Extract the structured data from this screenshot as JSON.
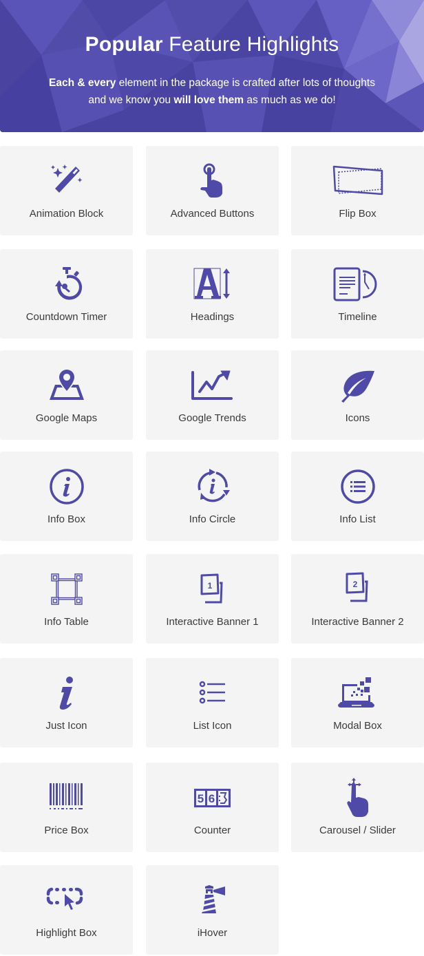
{
  "header": {
    "title_bold": "Popular",
    "title_rest": "Feature Highlights",
    "subtitle_line1_bold": "Each & every",
    "subtitle_line1_rest": "element in the package is crafted after lots of thoughts",
    "subtitle_line2_pre": "and we know you",
    "subtitle_line2_bold": "will love them",
    "subtitle_line2_post": "as much as we do!"
  },
  "colors": {
    "accent": "#4f4aa8",
    "banner": "#4e48a6",
    "card_bg": "#f4f4f4",
    "label": "#3a3a3a"
  },
  "features": [
    {
      "label": "Animation Block",
      "icon": "magic-wand-icon"
    },
    {
      "label": "Advanced Buttons",
      "icon": "pointer-tap-icon"
    },
    {
      "label": "Flip Box",
      "icon": "flip-box-icon"
    },
    {
      "label": "Countdown Timer",
      "icon": "stopwatch-icon"
    },
    {
      "label": "Headings",
      "icon": "heading-text-icon"
    },
    {
      "label": "Timeline",
      "icon": "document-clock-icon"
    },
    {
      "label": "Google Maps",
      "icon": "map-pin-icon"
    },
    {
      "label": "Google Trends",
      "icon": "trend-chart-icon"
    },
    {
      "label": "Icons",
      "icon": "leaf-icon"
    },
    {
      "label": "Info Box",
      "icon": "info-circle-icon"
    },
    {
      "label": "Info Circle",
      "icon": "info-cycle-icon"
    },
    {
      "label": "Info List",
      "icon": "list-circle-icon"
    },
    {
      "label": "Info Table",
      "icon": "table-frame-icon"
    },
    {
      "label": "Interactive Banner 1",
      "icon": "banner-one-icon"
    },
    {
      "label": "Interactive Banner 2",
      "icon": "banner-two-icon"
    },
    {
      "label": "Just Icon",
      "icon": "info-letter-icon"
    },
    {
      "label": "List Icon",
      "icon": "bullet-list-icon"
    },
    {
      "label": "Modal Box",
      "icon": "laptop-pixels-icon"
    },
    {
      "label": "Price Box",
      "icon": "barcode-icon"
    },
    {
      "label": "Counter",
      "icon": "counter-digits-icon"
    },
    {
      "label": "Carousel / Slider",
      "icon": "swipe-hand-icon"
    },
    {
      "label": "Highlight Box",
      "icon": "dashed-select-cursor-icon"
    },
    {
      "label": "iHover",
      "icon": "lighthouse-icon"
    }
  ]
}
